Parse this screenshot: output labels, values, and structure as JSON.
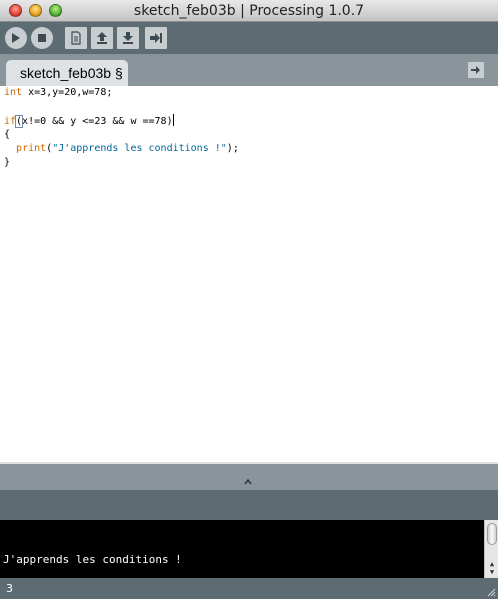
{
  "window": {
    "title": "sketch_feb03b | Processing 1.0.7"
  },
  "toolbar": {
    "buttons": [
      {
        "name": "run",
        "icon": "play-icon"
      },
      {
        "name": "stop",
        "icon": "stop-icon"
      },
      {
        "name": "new",
        "icon": "new-file-icon"
      },
      {
        "name": "open",
        "icon": "open-upload-icon"
      },
      {
        "name": "save",
        "icon": "save-download-icon"
      },
      {
        "name": "export",
        "icon": "export-icon"
      }
    ]
  },
  "tabs": {
    "active_label": "sketch_feb03b §",
    "menu_icon": "tab-arrow-icon"
  },
  "editor": {
    "line1_type": "int",
    "line1_rest": " x=3,y=20,w=78;",
    "line3_if": "if",
    "line3_open": "(",
    "line3_rest": "x!=0 && y <=23 && w ==78)",
    "line4": "{",
    "line5_indent": "  ",
    "line5_fn": "print",
    "line5_open": "(",
    "line5_str": "\"J'apprends les conditions !\"",
    "line5_close": ");",
    "line6": "}"
  },
  "console": {
    "output": "J'apprends les conditions !"
  },
  "status": {
    "line_number": "3"
  },
  "colors": {
    "toolbar": "#5d6b73",
    "tabbar": "#8a959b",
    "keyword": "#cc6600",
    "string": "#006699",
    "console_bg": "#000000"
  }
}
